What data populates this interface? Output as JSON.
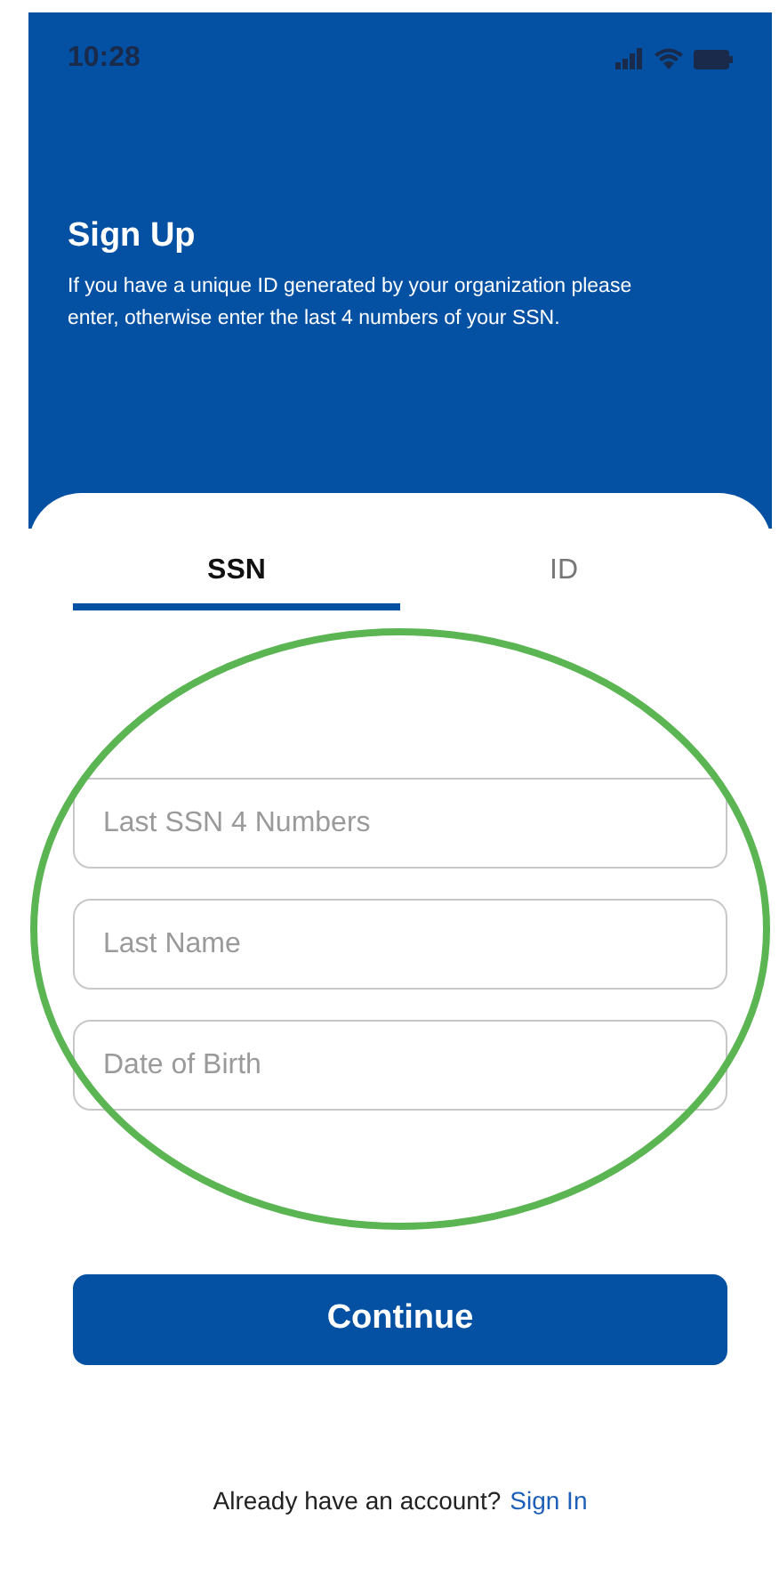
{
  "status_bar": {
    "time": "10:28"
  },
  "header": {
    "title": "Sign Up",
    "description": "If you have a unique ID generated by your organization please enter, otherwise enter the last 4 numbers of your SSN."
  },
  "tabs": [
    {
      "label": "SSN",
      "selected": true
    },
    {
      "label": "ID",
      "selected": false
    }
  ],
  "fields": [
    {
      "placeholder": "Last SSN 4 Numbers"
    },
    {
      "placeholder": "Last Name"
    },
    {
      "placeholder": "Date of Birth"
    }
  ],
  "continue_button": "Continue",
  "footer": {
    "prompt": "Already have an account?",
    "link": "Sign In"
  },
  "annotation": {
    "kind": "ellipse"
  }
}
